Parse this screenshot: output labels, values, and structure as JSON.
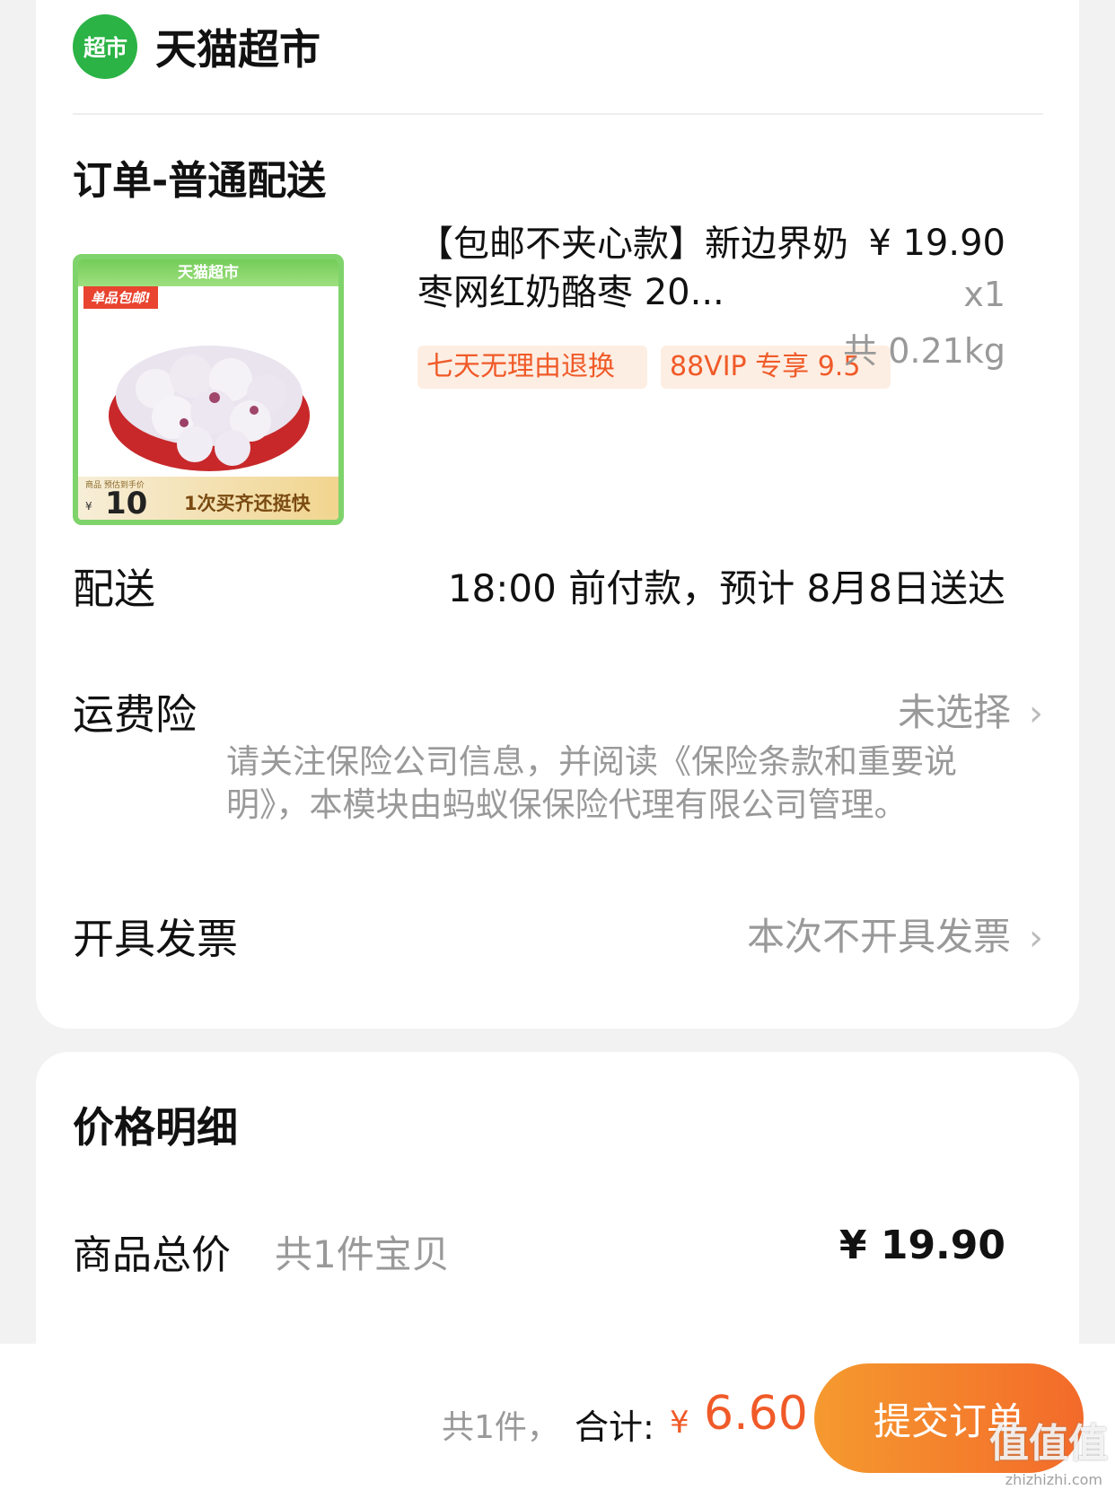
{
  "store": {
    "logo_text": "超市",
    "name": "天猫超市"
  },
  "order": {
    "title": "订单-普通配送",
    "product": {
      "title": "【包邮不夹心款】新边界奶枣网红奶酪枣 20...",
      "price": "¥ 19.90",
      "quantity": "x1",
      "weight": "共 0.21kg",
      "tags": [
        "七天无理由退换",
        "88VIP 专享 9.5"
      ],
      "image": {
        "top_banner": "天猫超市",
        "corner_tag": "单品包邮!",
        "price_label": "商品 预估到手价",
        "price_yen": "¥",
        "price": "10",
        "promo": "1次买齐还挺快"
      }
    },
    "delivery": {
      "label": "配送",
      "value": "18:00 前付款，预计 8月8日送达"
    },
    "insurance": {
      "label": "运费险",
      "value": "未选择",
      "note": "请关注保险公司信息，并阅读《保险条款和重要说明》，本模块由蚂蚁保保险代理有限公司管理。"
    },
    "invoice": {
      "label": "开具发票",
      "value": "本次不开具发票"
    }
  },
  "price_detail": {
    "title": "价格明细",
    "subtotal_label": "商品总价",
    "subtotal_count": "共1件宝贝",
    "subtotal_value": "¥ 19.90"
  },
  "bottom_bar": {
    "count": "共1件，",
    "total_label": "合计:",
    "yen": "¥",
    "amount": "6.60",
    "submit_label": "提交订单"
  },
  "watermark": {
    "text": "值值值",
    "url": "zhizhizhi.com"
  },
  "colors": {
    "accent": "#f05a28",
    "brand_green": "#2bb345",
    "submit_gradient_start": "#f59a2f",
    "submit_gradient_end": "#f36a2a"
  }
}
